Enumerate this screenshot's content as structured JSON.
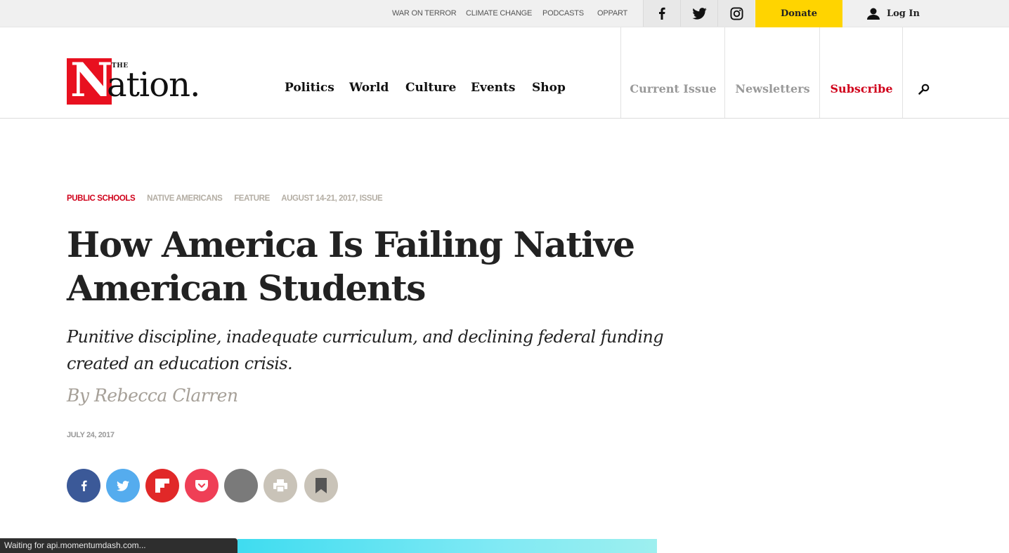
{
  "topbar": {
    "links": [
      "WAR ON TERROR",
      "CLIMATE CHANGE",
      "PODCASTS",
      "OPPART"
    ],
    "donate_label": "Donate",
    "login_label": "Log In"
  },
  "header": {
    "logo": {
      "the": "THE",
      "n": "N",
      "rest": "ation."
    },
    "nav": [
      "Politics",
      "World",
      "Culture",
      "Events",
      "Shop"
    ],
    "current_issue": "Current Issue",
    "newsletters": "Newsletters",
    "subscribe": "Subscribe"
  },
  "article": {
    "tags": [
      "PUBLIC SCHOOLS",
      "NATIVE AMERICANS",
      "FEATURE",
      "AUGUST 14-21, 2017, ISSUE"
    ],
    "headline_line1": "How America Is Failing Native",
    "headline_line2": "American Students",
    "dek_line1": "Punitive discipline, inadequate curriculum, and declining federal funding",
    "dek_line2": "created an education crisis.",
    "byline": "By Rebecca Clarren",
    "date": "JULY 24, 2017"
  },
  "share_buttons": [
    {
      "icon": "facebook-icon",
      "color": "#3b5998"
    },
    {
      "icon": "twitter-icon",
      "color": "#55acee"
    },
    {
      "icon": "flipboard-icon",
      "color": "#e12828"
    },
    {
      "icon": "pocket-icon",
      "color": "#ef3f56"
    },
    {
      "icon": "email-icon",
      "color": "#7a7a7a"
    },
    {
      "icon": "print-icon",
      "color": "#c9c3b8"
    },
    {
      "icon": "bookmark-icon",
      "color": "#c9c3b8"
    }
  ],
  "colors": {
    "accent_red": "#d0021b",
    "donate_yellow": "#ffd400",
    "logo_red": "#e8101f"
  },
  "status_bar": {
    "text": "Waiting for api.momentumdash.com..."
  }
}
